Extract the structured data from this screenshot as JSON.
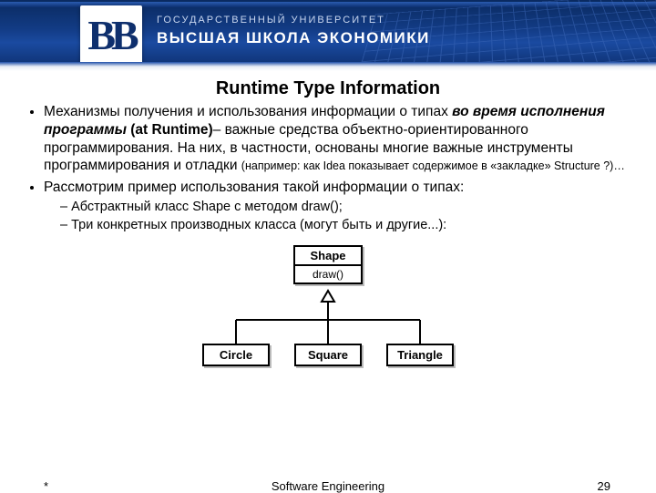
{
  "banner": {
    "logo_text": "ВВ",
    "line1": "ГОСУДАРСТВЕННЫЙ УНИВЕРСИТЕТ",
    "line2": "ВЫСШАЯ ШКОЛА ЭКОНОМИКИ"
  },
  "title": "Runtime Type Information",
  "bullet1": {
    "lead": "Механизмы получения и использования информации о типах ",
    "em": "во время исполнения программы",
    "spacer": "  ",
    "paren": "(at Runtime)",
    "tail": "– важные средства объектно-ориентированного программирования. На них, в частности, основаны многие важные  инструменты программирования и отладки ",
    "note": "(например: как Idea показывает содержимое в «закладке» Structure ?)…"
  },
  "bullet2": "Рассмотрим пример использования такой информации о типах:",
  "sub1": "Абстрактный класс Shape с методом draw();",
  "sub2": "Три конкретных производных класса (могут быть и другие...):",
  "diagram": {
    "parent": "Shape",
    "method": "draw()",
    "child1": "Circle",
    "child2": "Square",
    "child3": "Triangle"
  },
  "footer": {
    "left": "*",
    "center": "Software Engineering",
    "page": "29"
  }
}
